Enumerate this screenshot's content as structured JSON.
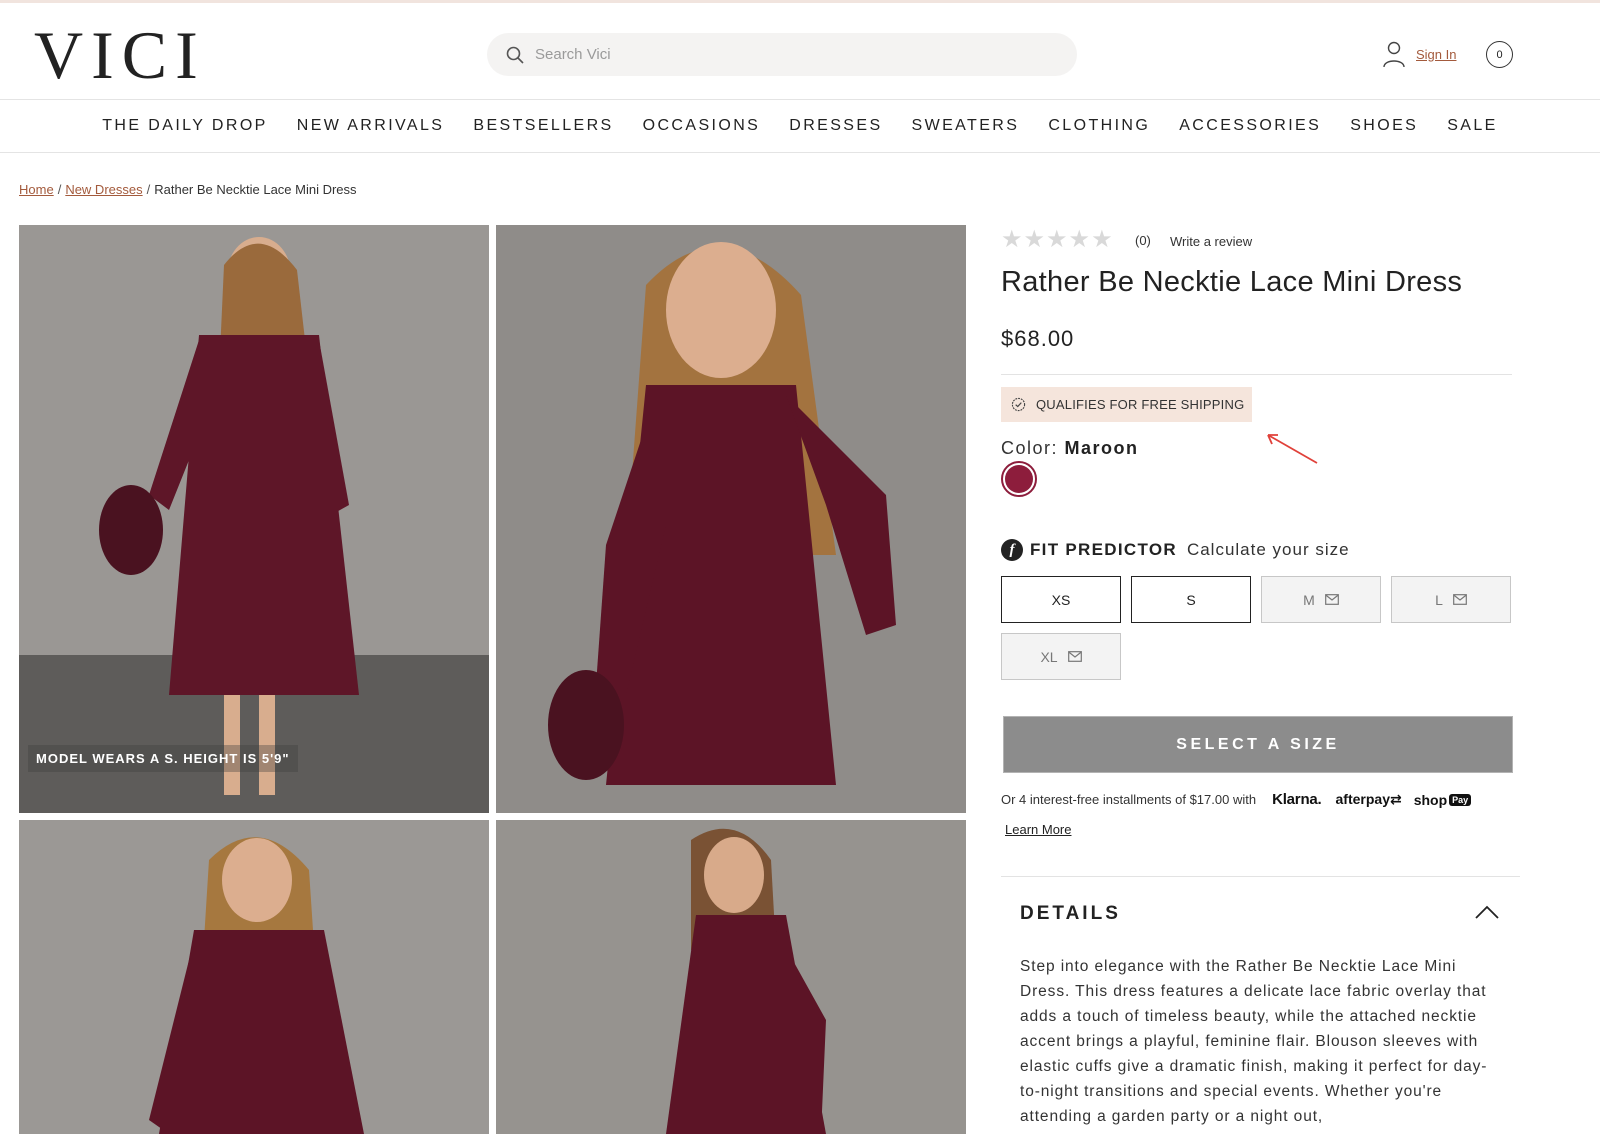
{
  "brand": {
    "logo": "VICI"
  },
  "search": {
    "placeholder": "Search Vici"
  },
  "account": {
    "sign_in": "Sign In",
    "cart_count": "0"
  },
  "nav": {
    "items": [
      "THE DAILY DROP",
      "NEW ARRIVALS",
      "BESTSELLERS",
      "OCCASIONS",
      "DRESSES",
      "SWEATERS",
      "CLOTHING",
      "ACCESSORIES",
      "SHOES",
      "SALE"
    ]
  },
  "breadcrumb": {
    "home": "Home",
    "category": "New Dresses",
    "current": "Rather Be Necktie Lace Mini Dress",
    "separator": "/"
  },
  "gallery": {
    "caption": "MODEL WEARS A S. HEIGHT IS 5'9\""
  },
  "product": {
    "rating_stars": 0,
    "reviews_count": "(0)",
    "write_review": "Write a review",
    "title": "Rather Be Necktie Lace Mini Dress",
    "price": "$68.00",
    "shipping_badge": "QUALIFIES FOR FREE SHIPPING",
    "color_label": "Color:",
    "color_value": "Maroon",
    "swatch_color": "#8d1d3c"
  },
  "fit_predictor": {
    "title": "FIT PREDICTOR",
    "link": "Calculate your size"
  },
  "sizes": [
    {
      "label": "XS",
      "available": true
    },
    {
      "label": "S",
      "available": true
    },
    {
      "label": "M",
      "available": false
    },
    {
      "label": "L",
      "available": false
    },
    {
      "label": "XL",
      "available": false
    }
  ],
  "cta": {
    "label": "SELECT A SIZE"
  },
  "payments": {
    "installments_text": "Or 4 interest-free installments of $17.00 with",
    "klarna": "Klarna.",
    "afterpay": "afterpay",
    "shoppay": "shop",
    "shoppay_badge": "Pay",
    "learn_more": "Learn More"
  },
  "details": {
    "heading": "DETAILS",
    "body": "Step into elegance with the Rather Be Necktie Lace Mini Dress. This dress features a delicate lace fabric overlay that adds a touch of timeless beauty, while the attached necktie accent brings a playful, feminine flair. Blouson sleeves with elastic cuffs give a dramatic finish, making it perfect for day-to-night transitions and special events. Whether you're attending a garden party or a night out,"
  },
  "colors": {
    "accent_link": "#a35a3c",
    "shipping_bg": "#f5e5dc",
    "cta_bg": "#8c8c8c",
    "annotation_arrow": "#e0413a"
  }
}
